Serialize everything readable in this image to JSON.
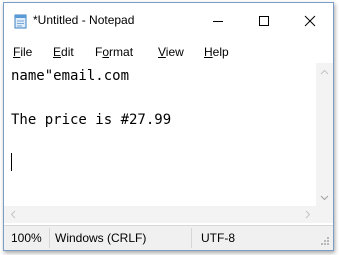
{
  "window": {
    "title": "*Untitled - Notepad",
    "controls": {
      "minimize_icon": "minimize-icon",
      "maximize_icon": "maximize-icon",
      "close_icon": "close-icon"
    }
  },
  "menubar": {
    "items": [
      {
        "mnemonic": "F",
        "rest": "ile"
      },
      {
        "mnemonic": "E",
        "rest": "dit"
      },
      {
        "pre": "F",
        "mnemonic": "o",
        "rest": "rmat"
      },
      {
        "mnemonic": "V",
        "rest": "iew"
      },
      {
        "mnemonic": "H",
        "rest": "elp"
      }
    ]
  },
  "editor": {
    "lines": [
      "name\"email.com",
      "",
      "The price is #27.99",
      ""
    ]
  },
  "statusbar": {
    "zoom": "100%",
    "line_ending": "Windows (CRLF)",
    "encoding": "UTF-8"
  },
  "colors": {
    "window_border": "#7a9ec6",
    "scrollbar_bg": "#f3f3f3",
    "statusbar_bg": "#f0f0f0"
  }
}
